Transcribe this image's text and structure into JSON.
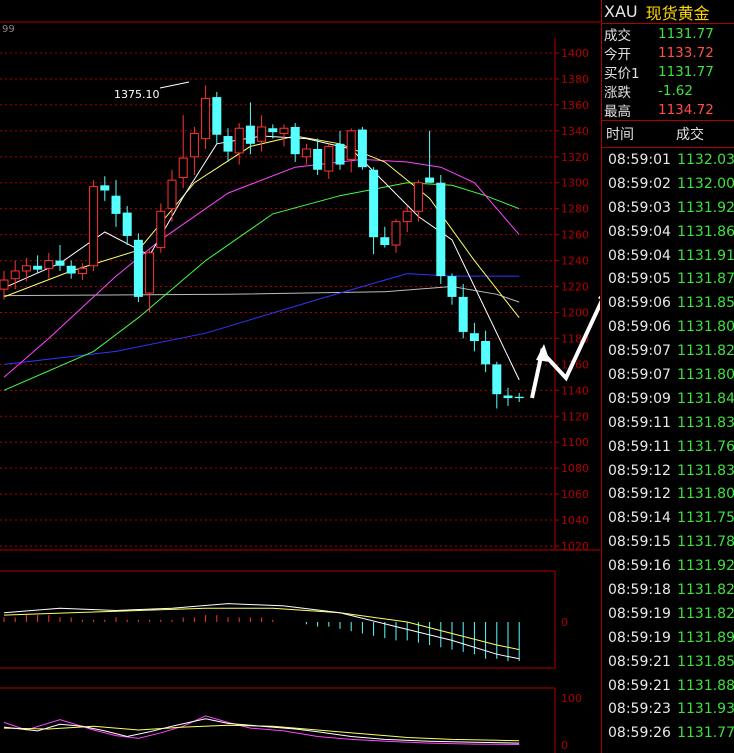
{
  "symbol": "XAU",
  "symbol_name": "现货黄金",
  "quotes": [
    {
      "label": "成交",
      "value": "1131.77",
      "color": "green"
    },
    {
      "label": "今开",
      "value": "1133.72",
      "color": "red"
    },
    {
      "label": "买价1",
      "value": "1131.77",
      "color": "green"
    },
    {
      "label": "涨跌",
      "value": "-1.62",
      "color": "green"
    },
    {
      "label": "最高",
      "value": "1134.72",
      "color": "red"
    }
  ],
  "ticks_header": {
    "time": "时间",
    "price": "成交"
  },
  "ticks": [
    {
      "time": "08:59:01",
      "price": "1132.03"
    },
    {
      "time": "08:59:02",
      "price": "1132.00"
    },
    {
      "time": "08:59:03",
      "price": "1131.92"
    },
    {
      "time": "08:59:04",
      "price": "1131.86"
    },
    {
      "time": "08:59:04",
      "price": "1131.91"
    },
    {
      "time": "08:59:05",
      "price": "1131.87"
    },
    {
      "time": "08:59:06",
      "price": "1131.85"
    },
    {
      "time": "08:59:06",
      "price": "1131.80"
    },
    {
      "time": "08:59:07",
      "price": "1131.82"
    },
    {
      "time": "08:59:07",
      "price": "1131.80"
    },
    {
      "time": "08:59:09",
      "price": "1131.84"
    },
    {
      "time": "08:59:11",
      "price": "1131.83"
    },
    {
      "time": "08:59:11",
      "price": "1131.76"
    },
    {
      "time": "08:59:12",
      "price": "1131.83"
    },
    {
      "time": "08:59:12",
      "price": "1131.80"
    },
    {
      "time": "08:59:14",
      "price": "1131.75"
    },
    {
      "time": "08:59:15",
      "price": "1131.78"
    },
    {
      "time": "08:59:16",
      "price": "1131.92"
    },
    {
      "time": "08:59:18",
      "price": "1131.82"
    },
    {
      "time": "08:59:19",
      "price": "1131.82"
    },
    {
      "time": "08:59:19",
      "price": "1131.89"
    },
    {
      "time": "08:59:21",
      "price": "1131.85"
    },
    {
      "time": "08:59:21",
      "price": "1131.88"
    },
    {
      "time": "08:59:23",
      "price": "1131.93"
    },
    {
      "time": "08:59:26",
      "price": "1131.77"
    }
  ],
  "chart_data": {
    "type": "candlestick",
    "corner_label": "99",
    "peak_annotation": "1375.10",
    "ylim": [
      1020,
      1400
    ],
    "yticks": [
      1400,
      1380,
      1360,
      1340,
      1320,
      1300,
      1280,
      1260,
      1240,
      1220,
      1200,
      1180,
      1160,
      1140,
      1120,
      1100,
      1080,
      1060,
      1040,
      1020
    ],
    "colors": {
      "up": "#ff3333",
      "down": "#55ffff",
      "ma5": "#ffffff",
      "ma10": "#ffff66",
      "ma20": "#ff44ff",
      "ma30": "#44ff44",
      "ma60": "#3333ff",
      "ma120": "#bbbbbb",
      "grid": "#b00000"
    },
    "candles": [
      {
        "o": 1218,
        "h": 1232,
        "l": 1210,
        "c": 1225
      },
      {
        "o": 1226,
        "h": 1240,
        "l": 1218,
        "c": 1232
      },
      {
        "o": 1232,
        "h": 1242,
        "l": 1224,
        "c": 1236
      },
      {
        "o": 1236,
        "h": 1244,
        "l": 1230,
        "c": 1233
      },
      {
        "o": 1234,
        "h": 1246,
        "l": 1226,
        "c": 1240
      },
      {
        "o": 1240,
        "h": 1252,
        "l": 1232,
        "c": 1236
      },
      {
        "o": 1236,
        "h": 1240,
        "l": 1226,
        "c": 1230
      },
      {
        "o": 1230,
        "h": 1238,
        "l": 1225,
        "c": 1234
      },
      {
        "o": 1236,
        "h": 1302,
        "l": 1232,
        "c": 1297
      },
      {
        "o": 1298,
        "h": 1305,
        "l": 1286,
        "c": 1294
      },
      {
        "o": 1290,
        "h": 1302,
        "l": 1266,
        "c": 1276
      },
      {
        "o": 1277,
        "h": 1282,
        "l": 1252,
        "c": 1259
      },
      {
        "o": 1256,
        "h": 1261,
        "l": 1208,
        "c": 1212
      },
      {
        "o": 1215,
        "h": 1248,
        "l": 1200,
        "c": 1246
      },
      {
        "o": 1250,
        "h": 1284,
        "l": 1246,
        "c": 1278
      },
      {
        "o": 1280,
        "h": 1310,
        "l": 1270,
        "c": 1302
      },
      {
        "o": 1304,
        "h": 1352,
        "l": 1296,
        "c": 1319
      },
      {
        "o": 1320,
        "h": 1343,
        "l": 1306,
        "c": 1338
      },
      {
        "o": 1334,
        "h": 1375,
        "l": 1326,
        "c": 1365
      },
      {
        "o": 1366,
        "h": 1370,
        "l": 1330,
        "c": 1337
      },
      {
        "o": 1336,
        "h": 1342,
        "l": 1316,
        "c": 1324
      },
      {
        "o": 1323,
        "h": 1346,
        "l": 1314,
        "c": 1342
      },
      {
        "o": 1344,
        "h": 1362,
        "l": 1322,
        "c": 1330
      },
      {
        "o": 1332,
        "h": 1352,
        "l": 1324,
        "c": 1343
      },
      {
        "o": 1342,
        "h": 1345,
        "l": 1334,
        "c": 1339
      },
      {
        "o": 1338,
        "h": 1345,
        "l": 1328,
        "c": 1342
      },
      {
        "o": 1343,
        "h": 1346,
        "l": 1316,
        "c": 1322
      },
      {
        "o": 1320,
        "h": 1330,
        "l": 1314,
        "c": 1326
      },
      {
        "o": 1326,
        "h": 1334,
        "l": 1306,
        "c": 1310
      },
      {
        "o": 1309,
        "h": 1330,
        "l": 1303,
        "c": 1328
      },
      {
        "o": 1330,
        "h": 1340,
        "l": 1310,
        "c": 1314
      },
      {
        "o": 1318,
        "h": 1342,
        "l": 1308,
        "c": 1340
      },
      {
        "o": 1341,
        "h": 1343,
        "l": 1310,
        "c": 1312
      },
      {
        "o": 1310,
        "h": 1312,
        "l": 1245,
        "c": 1258
      },
      {
        "o": 1258,
        "h": 1266,
        "l": 1250,
        "c": 1252
      },
      {
        "o": 1252,
        "h": 1272,
        "l": 1246,
        "c": 1270
      },
      {
        "o": 1270,
        "h": 1282,
        "l": 1262,
        "c": 1278
      },
      {
        "o": 1278,
        "h": 1302,
        "l": 1270,
        "c": 1300
      },
      {
        "o": 1304,
        "h": 1340,
        "l": 1300,
        "c": 1300
      },
      {
        "o": 1300,
        "h": 1306,
        "l": 1222,
        "c": 1228
      },
      {
        "o": 1228,
        "h": 1230,
        "l": 1206,
        "c": 1212
      },
      {
        "o": 1212,
        "h": 1222,
        "l": 1180,
        "c": 1185
      },
      {
        "o": 1184,
        "h": 1192,
        "l": 1170,
        "c": 1178
      },
      {
        "o": 1178,
        "h": 1186,
        "l": 1154,
        "c": 1160
      },
      {
        "o": 1160,
        "h": 1162,
        "l": 1126,
        "c": 1137
      },
      {
        "o": 1136,
        "h": 1142,
        "l": 1128,
        "c": 1134
      },
      {
        "o": 1135,
        "h": 1138,
        "l": 1131,
        "c": 1134
      }
    ],
    "ma5": [
      [
        0,
        1219
      ],
      [
        5,
        1238
      ],
      [
        9,
        1262
      ],
      [
        13,
        1244
      ],
      [
        16,
        1289
      ],
      [
        19,
        1330
      ],
      [
        23,
        1336
      ],
      [
        27,
        1334
      ],
      [
        31,
        1326
      ],
      [
        34,
        1300
      ],
      [
        37,
        1274
      ],
      [
        40,
        1256
      ],
      [
        43,
        1202
      ],
      [
        46,
        1148
      ]
    ],
    "ma10": [
      [
        0,
        1212
      ],
      [
        6,
        1232
      ],
      [
        12,
        1248
      ],
      [
        17,
        1300
      ],
      [
        22,
        1328
      ],
      [
        26,
        1336
      ],
      [
        30,
        1330
      ],
      [
        34,
        1316
      ],
      [
        38,
        1288
      ],
      [
        42,
        1240
      ],
      [
        46,
        1196
      ]
    ],
    "ma20": [
      [
        0,
        1150
      ],
      [
        4,
        1180
      ],
      [
        10,
        1228
      ],
      [
        14,
        1256
      ],
      [
        20,
        1292
      ],
      [
        26,
        1312
      ],
      [
        32,
        1318
      ],
      [
        36,
        1316
      ],
      [
        39,
        1312
      ],
      [
        42,
        1300
      ],
      [
        46,
        1260
      ]
    ],
    "ma30": [
      [
        0,
        1140
      ],
      [
        8,
        1170
      ],
      [
        12,
        1196
      ],
      [
        18,
        1240
      ],
      [
        24,
        1276
      ],
      [
        30,
        1290
      ],
      [
        36,
        1300
      ],
      [
        40,
        1298
      ],
      [
        43,
        1290
      ],
      [
        46,
        1280
      ]
    ],
    "ma60": [
      [
        0,
        1160
      ],
      [
        10,
        1170
      ],
      [
        18,
        1184
      ],
      [
        28,
        1210
      ],
      [
        36,
        1230
      ],
      [
        40,
        1228
      ],
      [
        46,
        1228
      ]
    ],
    "ma120": [
      [
        0,
        1213
      ],
      [
        20,
        1214
      ],
      [
        34,
        1216
      ],
      [
        40,
        1220
      ],
      [
        44,
        1214
      ],
      [
        46,
        1208
      ]
    ],
    "macd": {
      "zero_label": "0",
      "hist": [
        2,
        2,
        3,
        3,
        3,
        2,
        2,
        1,
        1,
        1,
        2,
        1,
        1,
        1,
        1,
        1,
        2,
        2,
        3,
        3,
        2,
        2,
        2,
        2,
        1,
        0,
        0,
        -1,
        -2,
        -2,
        -3,
        -4,
        -5,
        -6,
        -7,
        -8,
        -8,
        -9,
        -10,
        -11,
        -12,
        -13,
        -14,
        -16,
        -16,
        -17,
        -17
      ],
      "dif": [
        [
          0,
          4
        ],
        [
          5,
          6
        ],
        [
          10,
          5
        ],
        [
          15,
          6
        ],
        [
          20,
          8
        ],
        [
          25,
          7
        ],
        [
          30,
          4
        ],
        [
          35,
          -2
        ],
        [
          40,
          -8
        ],
        [
          44,
          -14
        ],
        [
          46,
          -16
        ]
      ],
      "dea": [
        [
          0,
          3
        ],
        [
          6,
          4
        ],
        [
          12,
          5
        ],
        [
          18,
          6
        ],
        [
          24,
          6
        ],
        [
          30,
          4
        ],
        [
          36,
          0
        ],
        [
          40,
          -5
        ],
        [
          44,
          -10
        ],
        [
          46,
          -12
        ]
      ]
    },
    "kdj": {
      "ylim": [
        0,
        100
      ],
      "tick_labels": [
        "100",
        "0"
      ],
      "k": [
        [
          0,
          38
        ],
        [
          3,
          30
        ],
        [
          5,
          44
        ],
        [
          7,
          40
        ],
        [
          9,
          30
        ],
        [
          11,
          18
        ],
        [
          13,
          28
        ],
        [
          15,
          40
        ],
        [
          18,
          56
        ],
        [
          20,
          46
        ],
        [
          23,
          40
        ],
        [
          26,
          34
        ],
        [
          28,
          28
        ],
        [
          31,
          18
        ],
        [
          34,
          12
        ],
        [
          38,
          8
        ],
        [
          42,
          6
        ],
        [
          46,
          4
        ]
      ],
      "d": [
        [
          0,
          36
        ],
        [
          4,
          34
        ],
        [
          8,
          40
        ],
        [
          12,
          32
        ],
        [
          16,
          38
        ],
        [
          20,
          42
        ],
        [
          24,
          40
        ],
        [
          28,
          32
        ],
        [
          32,
          24
        ],
        [
          36,
          16
        ],
        [
          40,
          12
        ],
        [
          44,
          10
        ],
        [
          46,
          9
        ]
      ],
      "j": [
        [
          0,
          48
        ],
        [
          2,
          32
        ],
        [
          5,
          54
        ],
        [
          8,
          32
        ],
        [
          10,
          20
        ],
        [
          12,
          14
        ],
        [
          14,
          26
        ],
        [
          16,
          40
        ],
        [
          18,
          62
        ],
        [
          20,
          48
        ],
        [
          22,
          36
        ],
        [
          25,
          30
        ],
        [
          28,
          18
        ],
        [
          31,
          12
        ],
        [
          34,
          8
        ],
        [
          38,
          4
        ],
        [
          42,
          2
        ],
        [
          46,
          1
        ]
      ]
    }
  }
}
